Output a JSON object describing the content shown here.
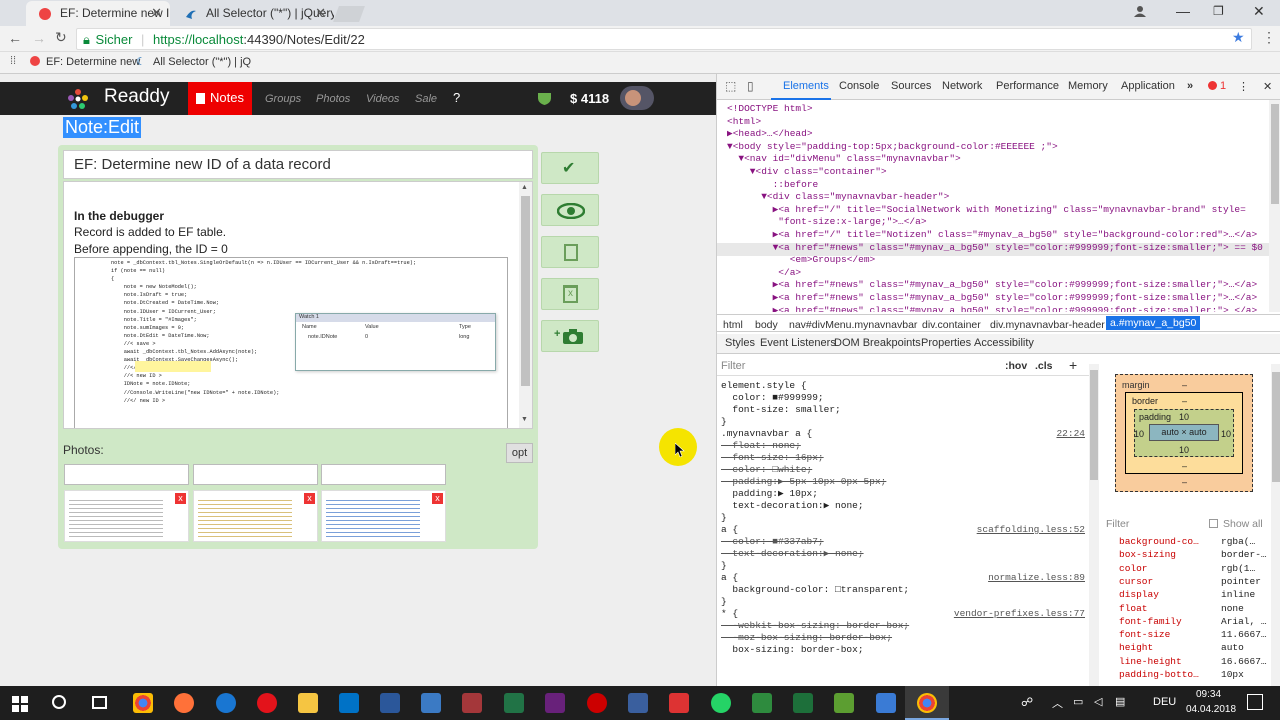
{
  "browser": {
    "tabs": [
      {
        "title": "EF: Determine new ID"
      },
      {
        "title": "All Selector (\"*\") | jQuery"
      }
    ],
    "secure_label": "Sicher",
    "url_base": "https://localhost",
    "url_rest": ":44390/Notes/Edit/22",
    "bookmarks": [
      "EF: Determine new",
      "All Selector (\"*\") | jQ"
    ]
  },
  "site": {
    "brand": "Readdy",
    "nav": {
      "notes": "Notes",
      "groups": "Groups",
      "photos": "Photos",
      "videos": "Videos",
      "sale": "Sale",
      "help": "?"
    },
    "balance": "$ 4118",
    "page_title": "Note:Edit",
    "note_title": "EF: Determine new ID of a data record",
    "body": {
      "heading": "In the debugger",
      "line1": "Record is added to EF table.",
      "line2": "Before appending, the ID = 0"
    },
    "photos_label": "Photos:",
    "opt_label": "opt",
    "watch": {
      "title": "Watch 1",
      "cols": [
        "Name",
        "Value",
        "Type"
      ],
      "row": [
        "note.IDNote",
        "0",
        "long"
      ]
    },
    "code_lines": [
      "note = _dbContext.tbl_Notes.SingleOrDefault(n => n.IDUser == IDCurrent_User && n.IsDraft==true);",
      "if (note == null)",
      "{",
      "    note = new NoteModel();",
      "    note.IsDraft = true;",
      "    note.DtCreated = DateTime.Now;",
      "    note.IDUser = IDCurrent_User;",
      "    note.Title = \"#Images\";",
      "    note.sumImages = 0;",
      "    note.DtEdit = DateTime.Now;",
      "",
      "    //< save >",
      "    await _dbContext.tbl_Notes.AddAsync(note);",
      "    await _dbContext.SaveChangesAsync();",
      "    //</ save >",
      "",
      "    //< new ID >",
      "    IDNote = note.IDNote;",
      "    //Console.WriteLine(\"new IDNote=\" + note.IDNote);",
      "    //</ new ID >"
    ]
  },
  "devtools": {
    "tabs": [
      "Elements",
      "Console",
      "Sources",
      "Network",
      "Performance",
      "Memory",
      "Application"
    ],
    "error_count": "1",
    "dom_lines": [
      "<!DOCTYPE html>",
      "<html>",
      "▶<head>…</head>",
      "▼<body style=\"padding-top:5px;background-color:#EEEEEE ;\">",
      "  ▼<nav id=\"divMenu\" class=\"mynavnavbar\">",
      "    ▼<div class=\"container\">",
      "        ::before",
      "      ▼<div class=\"mynavnavbar-header\">",
      "        ▶<a href=\"/\" title=\"SocialNetwork with Monetizing\" class=\"mynavnavbar-brand\" style=",
      "         \"font-size:x-large;\">…</a>",
      "        ▶<a href=\"/\" title=\"Notizen\" class=\"#mynav_a_bg50\" style=\"background-color:red\">…</a>",
      "        ▼<a href=\"#news\" class=\"#mynav_a_bg50\" style=\"color:#999999;font-size:smaller;\"> == $0",
      "           <em>Groups</em>",
      "         </a>",
      "        ▶<a href=\"#news\" class=\"#mynav_a_bg50\" style=\"color:#999999;font-size:smaller;\">…</a>",
      "        ▶<a href=\"#news\" class=\"#mynav_a_bg50\" style=\"color:#999999;font-size:smaller;\">…</a>",
      "        ▶<a href=\"#news\" class=\"#mynav_a_bg50\" style=\"color:#999999;font-size:smaller;\">…</a>"
    ],
    "breadcrumbs": [
      "html",
      "body",
      "nav#divMenu.mynavnavbar",
      "div.container",
      "div.mynavnavbar-header",
      "a.#mynav_a_bg50"
    ],
    "style_tabs": [
      "Styles",
      "Event Listeners",
      "DOM Breakpoints",
      "Properties",
      "Accessibility"
    ],
    "filter_placeholder": "Filter",
    "hov": ":hov",
    "cls": ".cls",
    "css_rules": [
      {
        "text": "element.style {",
        "strike": false
      },
      {
        "text": "  color: ■#999999;",
        "strike": false
      },
      {
        "text": "  font-size: smaller;",
        "strike": false
      },
      {
        "text": "}",
        "strike": false
      },
      {
        "text": ".mynavnavbar a {",
        "strike": false,
        "src": "22:24"
      },
      {
        "text": "  float: none;",
        "strike": true
      },
      {
        "text": "  font-size: 16px;",
        "strike": true
      },
      {
        "text": "  color: □white;",
        "strike": true
      },
      {
        "text": "  padding:▶ 5px 10px 0px 5px;",
        "strike": true
      },
      {
        "text": "  padding:▶ 10px;",
        "strike": false
      },
      {
        "text": "  text-decoration:▶ none;",
        "strike": false
      },
      {
        "text": "}",
        "strike": false
      },
      {
        "text": "a {",
        "strike": false,
        "src": "scaffolding.less:52"
      },
      {
        "text": "  color: ■#337ab7;",
        "strike": true
      },
      {
        "text": "  text-decoration:▶ none;",
        "strike": true
      },
      {
        "text": "}",
        "strike": false
      },
      {
        "text": "a {",
        "strike": false,
        "src": "normalize.less:89"
      },
      {
        "text": "  background-color: □transparent;",
        "strike": false
      },
      {
        "text": "}",
        "strike": false
      },
      {
        "text": "* {",
        "strike": false,
        "src": "vendor-prefixes.less:77"
      },
      {
        "text": "  -webkit-box-sizing: border-box;",
        "strike": true
      },
      {
        "text": "  -moz-box-sizing: border-box;",
        "strike": true
      },
      {
        "text": "  box-sizing: border-box;",
        "strike": false
      }
    ],
    "box_model": {
      "margin": "margin",
      "border": "border",
      "padding": "padding",
      "content": "auto × auto",
      "dash": "–",
      "pad": "10"
    },
    "computed_filter": "Filter",
    "show_all": "Show all",
    "computed": [
      {
        "k": "background-co…",
        "v": "rgba(…"
      },
      {
        "k": "box-sizing",
        "v": "border-…"
      },
      {
        "k": "color",
        "v": "rgb(1…"
      },
      {
        "k": "cursor",
        "v": "pointer"
      },
      {
        "k": "display",
        "v": "inline"
      },
      {
        "k": "float",
        "v": "none"
      },
      {
        "k": "font-family",
        "v": "Arial, …"
      },
      {
        "k": "font-size",
        "v": "11.6667…"
      },
      {
        "k": "height",
        "v": "auto"
      },
      {
        "k": "line-height",
        "v": "16.6667…"
      },
      {
        "k": "padding-botto…",
        "v": "10px"
      }
    ]
  },
  "taskbar": {
    "lang": "DEU",
    "time": "09:34",
    "date": "04.04.2018"
  }
}
